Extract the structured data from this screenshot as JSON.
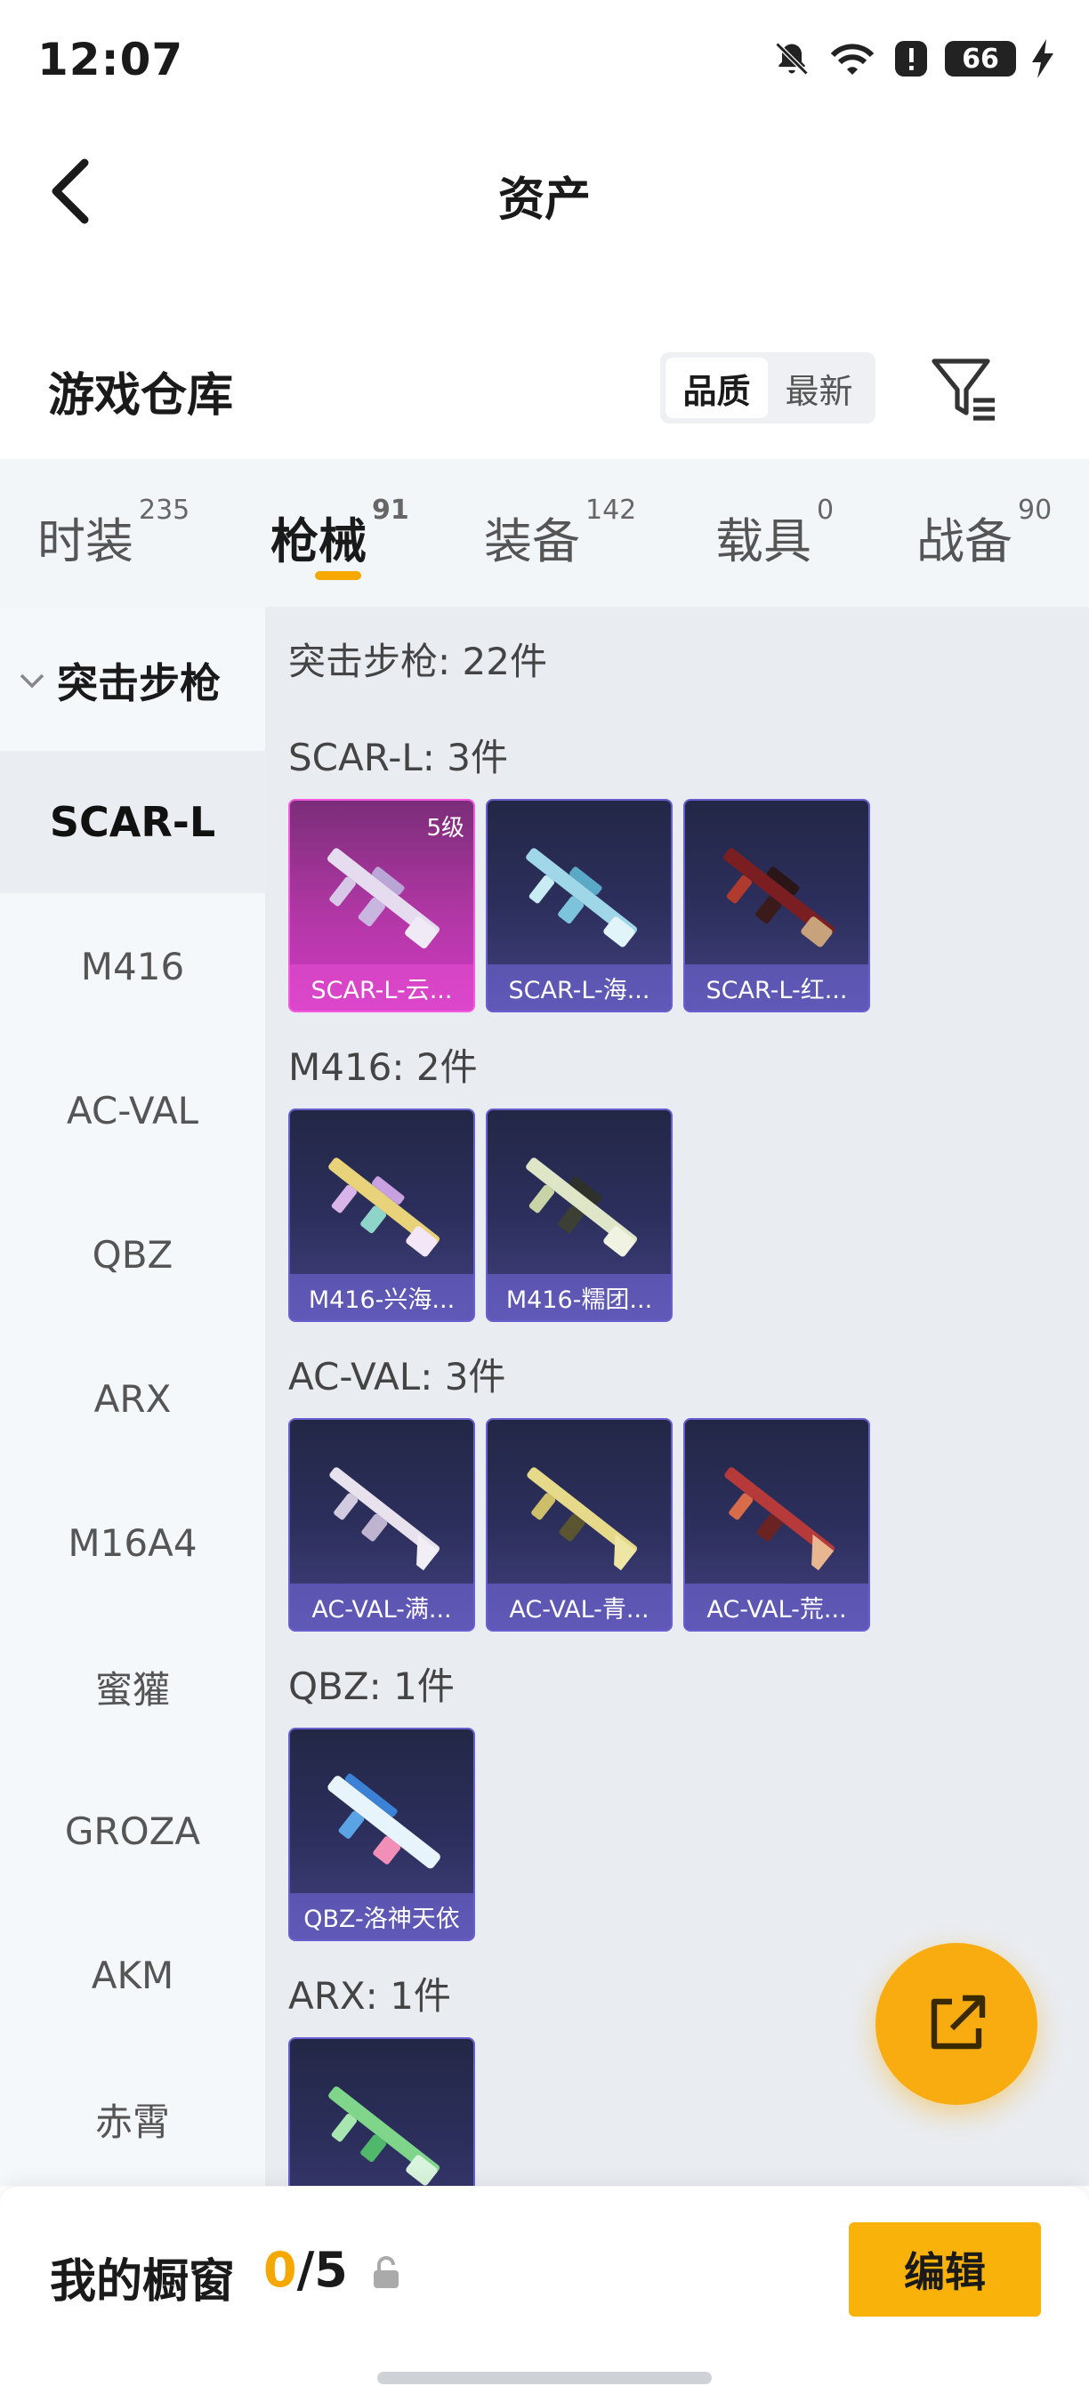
{
  "status_bar": {
    "time": "12:07",
    "battery": "66"
  },
  "header": {
    "title": "资产"
  },
  "section": {
    "title": "游戏仓库",
    "sort_options": [
      "品质",
      "最新"
    ],
    "active_sort": "品质"
  },
  "tabs": [
    {
      "label": "时装",
      "count": "235"
    },
    {
      "label": "枪械",
      "count": "91"
    },
    {
      "label": "装备",
      "count": "142"
    },
    {
      "label": "载具",
      "count": "0"
    },
    {
      "label": "战备",
      "count": "90"
    }
  ],
  "active_tab": "枪械",
  "sidebar": {
    "category": "突击步枪",
    "items": [
      "SCAR-L",
      "M416",
      "AC-VAL",
      "QBZ",
      "ARX",
      "M16A4",
      "蜜獾",
      "GROZA",
      "AKM",
      "赤霄"
    ],
    "active_item": "SCAR-L"
  },
  "content": {
    "category_header": "突击步枪: 22件",
    "groups": [
      {
        "header": "SCAR-L: 3件",
        "cards": [
          {
            "label": "SCAR-L-云...",
            "level": "5级",
            "tier": "gold"
          },
          {
            "label": "SCAR-L-海...",
            "tier": "purple"
          },
          {
            "label": "SCAR-L-红...",
            "tier": "purple"
          }
        ]
      },
      {
        "header": "M416: 2件",
        "cards": [
          {
            "label": "M416-兴海...",
            "tier": "purple"
          },
          {
            "label": "M416-糯团...",
            "tier": "purple"
          }
        ]
      },
      {
        "header": "AC-VAL: 3件",
        "cards": [
          {
            "label": "AC-VAL-满...",
            "tier": "purple"
          },
          {
            "label": "AC-VAL-青...",
            "tier": "purple"
          },
          {
            "label": "AC-VAL-荒...",
            "tier": "purple"
          }
        ]
      },
      {
        "header": "QBZ: 1件",
        "cards": [
          {
            "label": "QBZ-洛神天依",
            "tier": "purple"
          }
        ]
      },
      {
        "header": "ARX: 1件",
        "cards": [
          {
            "label": "",
            "tier": "purple"
          }
        ]
      }
    ]
  },
  "bottom_bar": {
    "title": "我的橱窗",
    "count_current": "0",
    "count_total": "/5",
    "edit_label": "编辑"
  },
  "colors": {
    "accent": "#f8b20a",
    "gold_tier": "#d03ac2",
    "purple_tier": "#43407f"
  }
}
